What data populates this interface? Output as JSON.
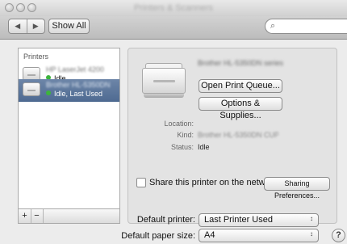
{
  "window": {
    "title": "Printers & Scanners"
  },
  "toolbar": {
    "back_icon": "chevron-left-icon",
    "forward_icon": "chevron-right-icon",
    "show_all_label": "Show All",
    "search_placeholder": "",
    "search_icon": "magnifier-icon"
  },
  "printers_list": {
    "header": "Printers",
    "items": [
      {
        "name": "HP LaserJet 4200",
        "status": "Idle",
        "selected": false
      },
      {
        "name": "Brother HL-5350DN",
        "status": "Idle, Last Used",
        "selected": true
      }
    ],
    "add_label": "+",
    "remove_label": "−"
  },
  "detail": {
    "printer_name": "Brother HL-5350DN series",
    "open_queue_label": "Open Print Queue...",
    "options_label": "Options & Supplies...",
    "location_label": "Location:",
    "location_value": "",
    "kind_label": "Kind:",
    "kind_value": "Brother HL-5350DN CUPS",
    "status_label": "Status:",
    "status_value": "Idle",
    "share_label": "Share this printer on the network",
    "share_checked": false,
    "sharing_prefs_label": "Sharing Preferences..."
  },
  "defaults": {
    "default_printer_label": "Default printer:",
    "default_printer_value": "Last Printer Used",
    "default_paper_label": "Default paper size:",
    "default_paper_value": "A4"
  },
  "help_label": "?"
}
